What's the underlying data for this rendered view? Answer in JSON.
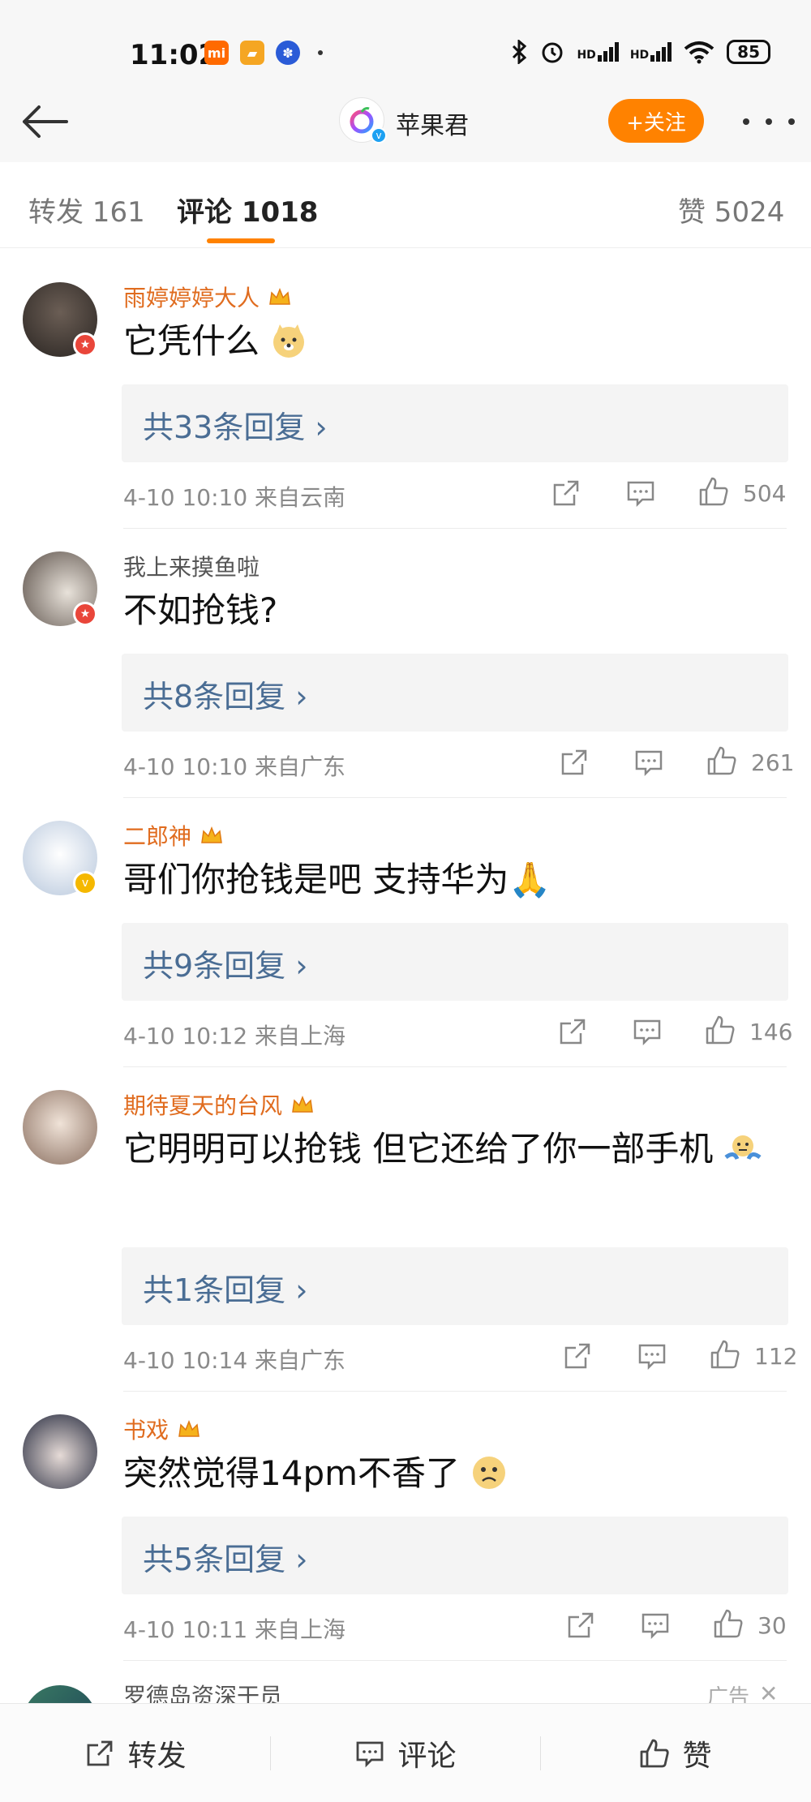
{
  "status_bar": {
    "time": "11:02",
    "signal_label": "HD",
    "battery": "85"
  },
  "header": {
    "title": "苹果君",
    "follow_label": "+关注"
  },
  "tabs": {
    "repost": "转发 161",
    "comment": "评论 1018",
    "like": "赞 5024"
  },
  "comments": [
    {
      "name": "雨婷婷婷大人",
      "name_style": "vip",
      "text": "它凭什么",
      "emoji": "doge",
      "reply_label": "共33条回复 ›",
      "meta": "4-10 10:10  来自云南",
      "likes": "504",
      "avatar_color": "#3b3530",
      "badge_color": "#e9463a"
    },
    {
      "name": "我上来摸鱼啦",
      "name_style": "plain",
      "text": "不如抢钱?",
      "emoji": "",
      "reply_label": "共8条回复 ›",
      "meta": "4-10 10:10  来自广东",
      "likes": "261",
      "avatar_color": "#8a7f75",
      "badge_color": "#e9463a"
    },
    {
      "name": "二郎神",
      "name_style": "vip",
      "text": "哥们你抢钱是吧 支持华为🙏",
      "emoji": "",
      "reply_label": "共9条回复 ›",
      "meta": "4-10 10:12  来自上海",
      "likes": "146",
      "avatar_color": "#c9d6e6",
      "badge_color": "#f5b800"
    },
    {
      "name": "期待夏天的台风",
      "name_style": "vip",
      "text": "它明明可以抢钱 但它还给了你一部手机",
      "emoji": "shrug",
      "reply_label": "共1条回复 ›",
      "meta": "4-10 10:14  来自广东",
      "likes": "112",
      "avatar_color": "#d8c8bd",
      "badge_color": ""
    },
    {
      "name": "书戏",
      "name_style": "vip",
      "text": "突然觉得14pm不香了",
      "emoji": "sad",
      "reply_label": "共5条回复 ›",
      "meta": "4-10 10:11  来自上海",
      "likes": "30",
      "avatar_color": "#2f3a55",
      "badge_color": ""
    }
  ],
  "partial_comment": {
    "name": "罗德岛资深干员",
    "ad_label": "广告"
  },
  "bottom_bar": {
    "repost": "转发",
    "comment": "评论",
    "like": "赞"
  },
  "colors": {
    "accent": "#ff8200",
    "vip_name": "#e06c1f",
    "reply_link": "#4a6d94"
  }
}
